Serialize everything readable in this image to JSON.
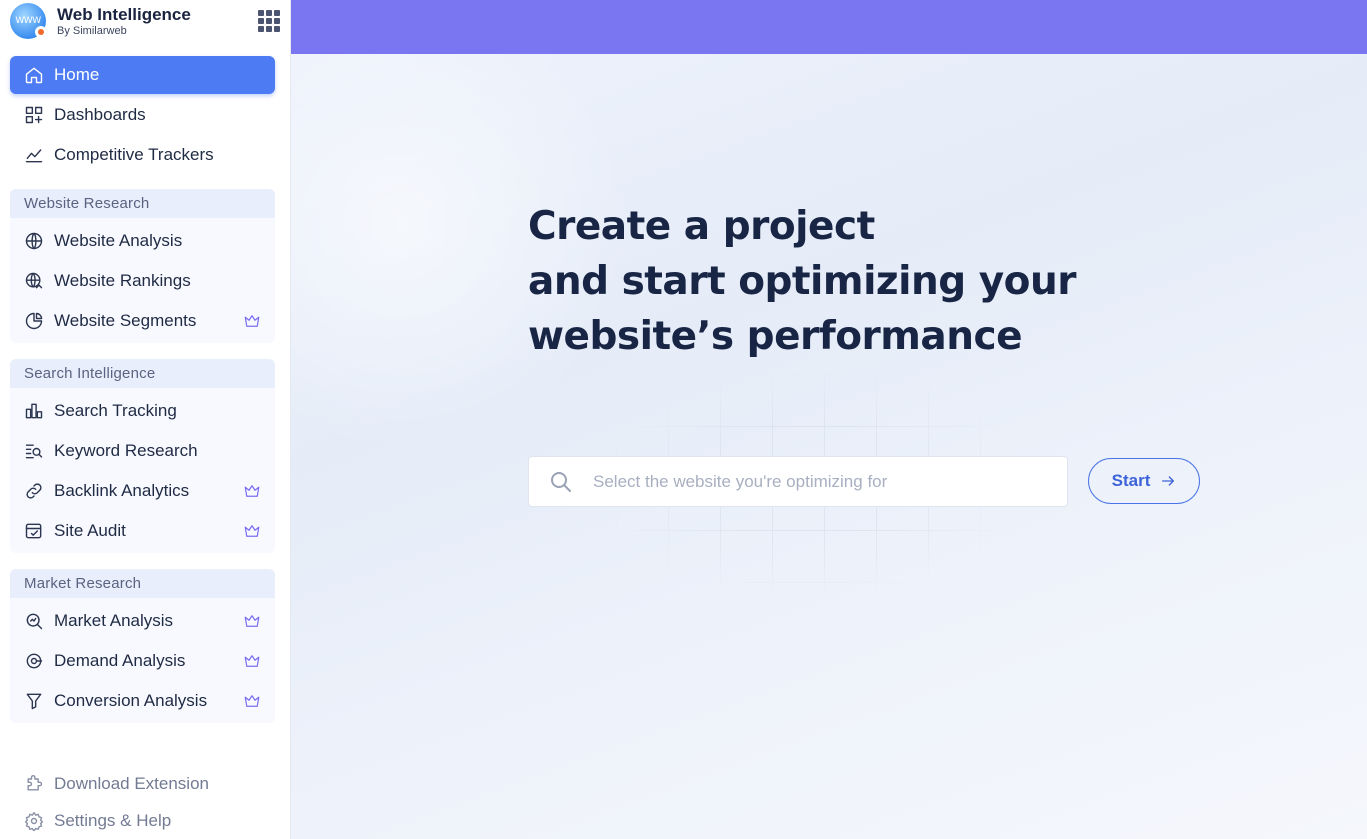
{
  "brand": {
    "title": "Web Intelligence",
    "subtitle": "By Similarweb",
    "logo_text": "WWW"
  },
  "nav": {
    "home": "Home",
    "dashboards": "Dashboards",
    "competitive_trackers": "Competitive Trackers"
  },
  "groups": {
    "website_research": {
      "title": "Website Research",
      "items": [
        "Website Analysis",
        "Website Rankings",
        "Website Segments"
      ]
    },
    "search_intelligence": {
      "title": "Search Intelligence",
      "items": [
        "Search Tracking",
        "Keyword Research",
        "Backlink Analytics",
        "Site Audit"
      ]
    },
    "market_research": {
      "title": "Market Research",
      "items": [
        "Market Analysis",
        "Demand Analysis",
        "Conversion Analysis"
      ]
    }
  },
  "footer": {
    "download_extension": "Download Extension",
    "settings_help": "Settings & Help"
  },
  "hero": {
    "line1_bold": "Create",
    "line1_rest": " a project",
    "line2": "and start optimizing your",
    "line3": "website’s performance"
  },
  "search": {
    "placeholder": "Select the website you're optimizing for",
    "value": ""
  },
  "start_button": "Start",
  "colors": {
    "accent": "#4c7bf3",
    "topbar": "#7a76f2",
    "premium": "#7a6cf0"
  }
}
